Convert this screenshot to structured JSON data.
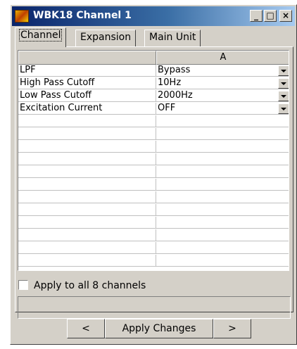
{
  "window": {
    "title": "WBK18 Channel 1",
    "controls": {
      "minimize": "_",
      "maximize": "□",
      "close": "×"
    }
  },
  "tabs": [
    {
      "label": "Channel",
      "active": true
    },
    {
      "label": "Expansion",
      "active": false
    },
    {
      "label": "Main Unit",
      "active": false
    }
  ],
  "grid": {
    "column_headers": [
      "",
      "A"
    ],
    "rows": [
      {
        "name": "LPF",
        "value": "Bypass"
      },
      {
        "name": "High Pass Cutoff",
        "value": "10Hz"
      },
      {
        "name": "Low Pass Cutoff",
        "value": "2000Hz"
      },
      {
        "name": "Excitation Current",
        "value": "OFF"
      }
    ]
  },
  "apply_all": {
    "label": "Apply to all 8 channels",
    "checked": false
  },
  "buttons": {
    "prev": "<",
    "apply": "Apply Changes",
    "next": ">"
  },
  "icons": {
    "app": "wbk18-app-icon",
    "dropdown": "dropdown-arrow-icon"
  },
  "colors": {
    "titlebar_start": "#0a246a",
    "titlebar_end": "#a6caf0",
    "face": "#d4d0c8"
  }
}
